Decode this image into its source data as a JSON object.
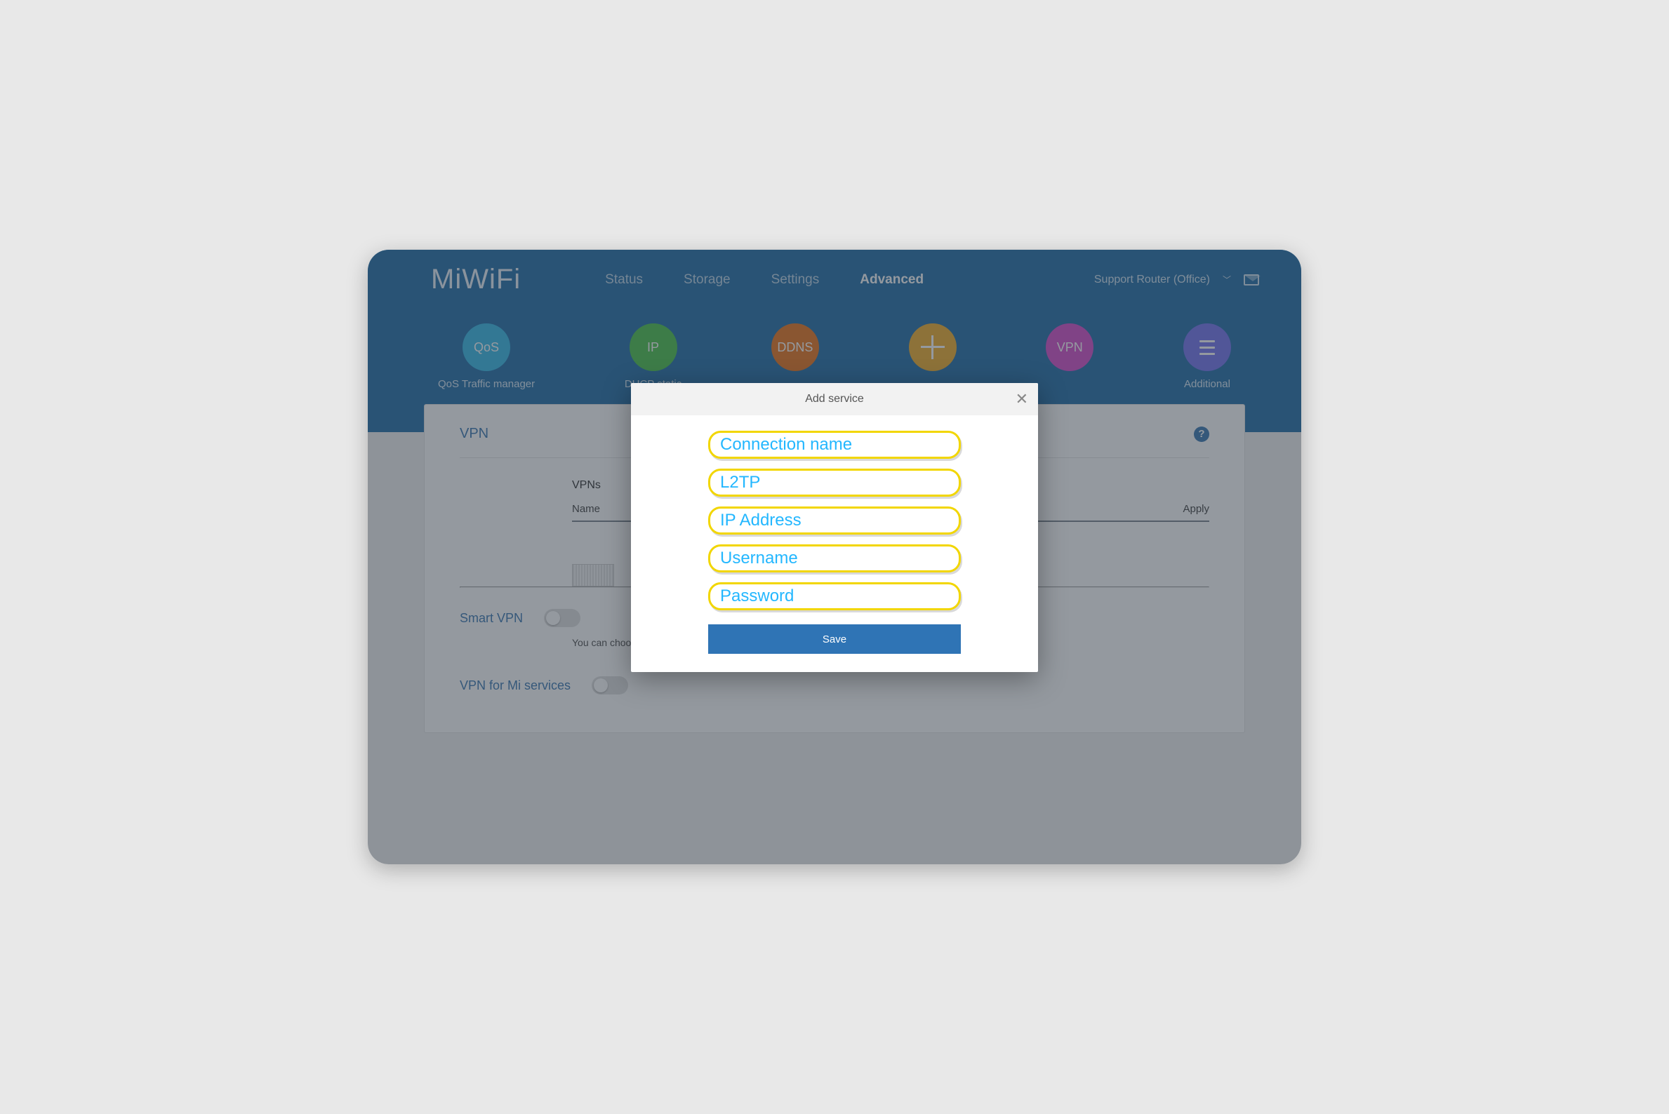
{
  "brand": "MiWiFi",
  "nav": {
    "status": "Status",
    "storage": "Storage",
    "settings": "Settings",
    "advanced": "Advanced"
  },
  "account": {
    "label": "Support Router (Office)"
  },
  "subnav": {
    "qos": {
      "icon": "QoS",
      "label": "QoS Traffic manager"
    },
    "ip": {
      "icon": "IP",
      "label": "DHCP static"
    },
    "ddns": {
      "icon": "DDNS",
      "label": ""
    },
    "portfwd": {
      "label": ""
    },
    "vpn": {
      "icon": "VPN",
      "label": ""
    },
    "additional": {
      "label": "Additional"
    }
  },
  "page": {
    "section": "VPN",
    "list_heading": "VPNs",
    "col_name": "Name",
    "col_apply": "Apply",
    "smart_label": "Smart VPN",
    "hint": "You can choose which services or devices can use VPN traffic",
    "mi_label": "VPN for Mi services"
  },
  "modal": {
    "title": "Add service",
    "fields": {
      "conn_name": "Connection name",
      "protocol": "L2TP",
      "ip": "IP Address",
      "user": "Username",
      "pass": "Password"
    },
    "save": "Save"
  }
}
